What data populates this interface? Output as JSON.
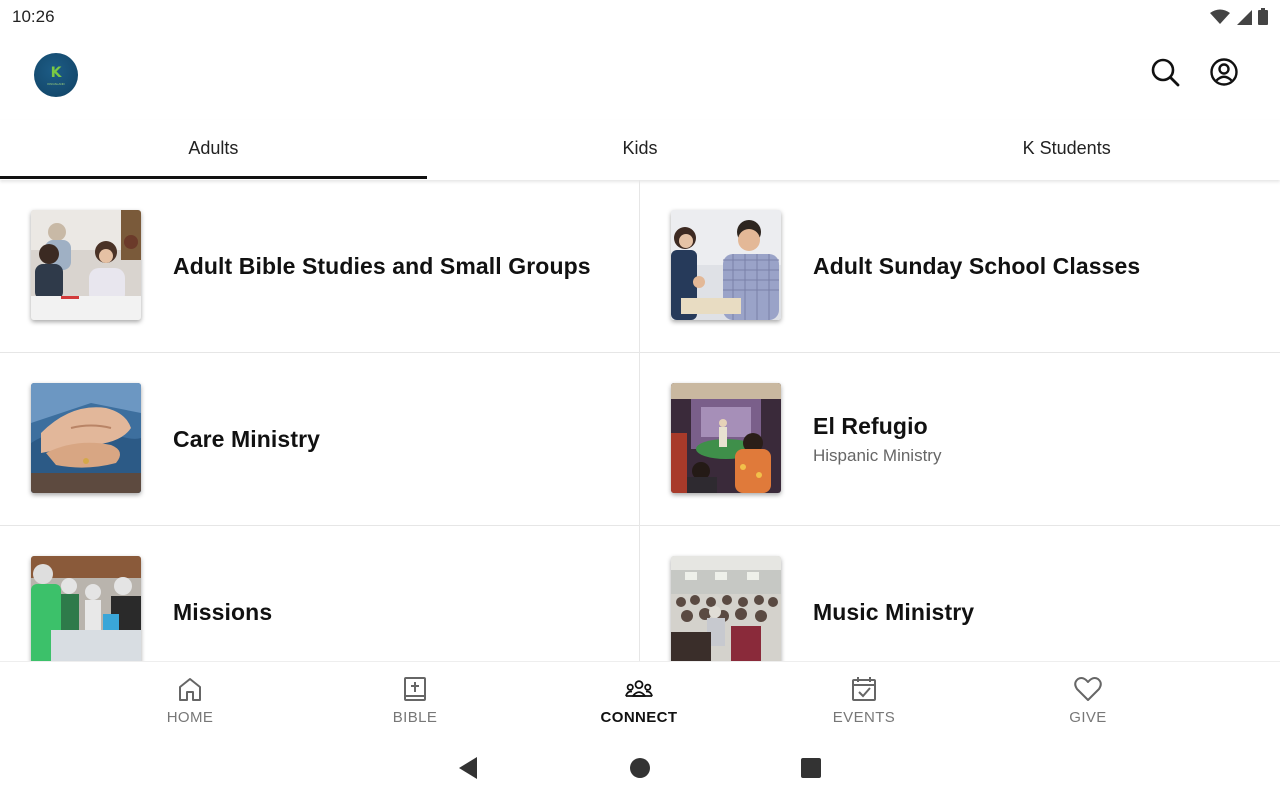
{
  "status_bar": {
    "time": "10:26",
    "icons": [
      "wifi-icon",
      "cell-signal-icon",
      "battery-icon"
    ]
  },
  "header": {
    "logo": {
      "letter": "K",
      "subtext": "KINGSLAND"
    },
    "actions": [
      "search-icon",
      "account-icon"
    ]
  },
  "tabs": [
    {
      "label": "Adults",
      "active": true
    },
    {
      "label": "Kids",
      "active": false
    },
    {
      "label": "K Students",
      "active": false
    }
  ],
  "cards": [
    {
      "title": "Adult Bible Studies and Small Groups",
      "subtitle": ""
    },
    {
      "title": "Adult Sunday School Classes",
      "subtitle": ""
    },
    {
      "title": "Care Ministry",
      "subtitle": ""
    },
    {
      "title": "El Refugio",
      "subtitle": "Hispanic Ministry"
    },
    {
      "title": "Missions",
      "subtitle": ""
    },
    {
      "title": "Music Ministry",
      "subtitle": ""
    }
  ],
  "bottom_nav": [
    {
      "label": "HOME",
      "icon": "home-icon",
      "active": false
    },
    {
      "label": "BIBLE",
      "icon": "bible-icon",
      "active": false
    },
    {
      "label": "CONNECT",
      "icon": "people-icon",
      "active": true
    },
    {
      "label": "EVENTS",
      "icon": "calendar-check-icon",
      "active": false
    },
    {
      "label": "GIVE",
      "icon": "heart-icon",
      "active": false
    }
  ],
  "system_nav": [
    "back-icon",
    "home-circle-icon",
    "recents-icon"
  ],
  "colors": {
    "text": "#111111",
    "muted": "#777777",
    "divider": "#e6e6e6",
    "logo_bg": "#144a6e",
    "logo_accent": "#7ac943"
  }
}
